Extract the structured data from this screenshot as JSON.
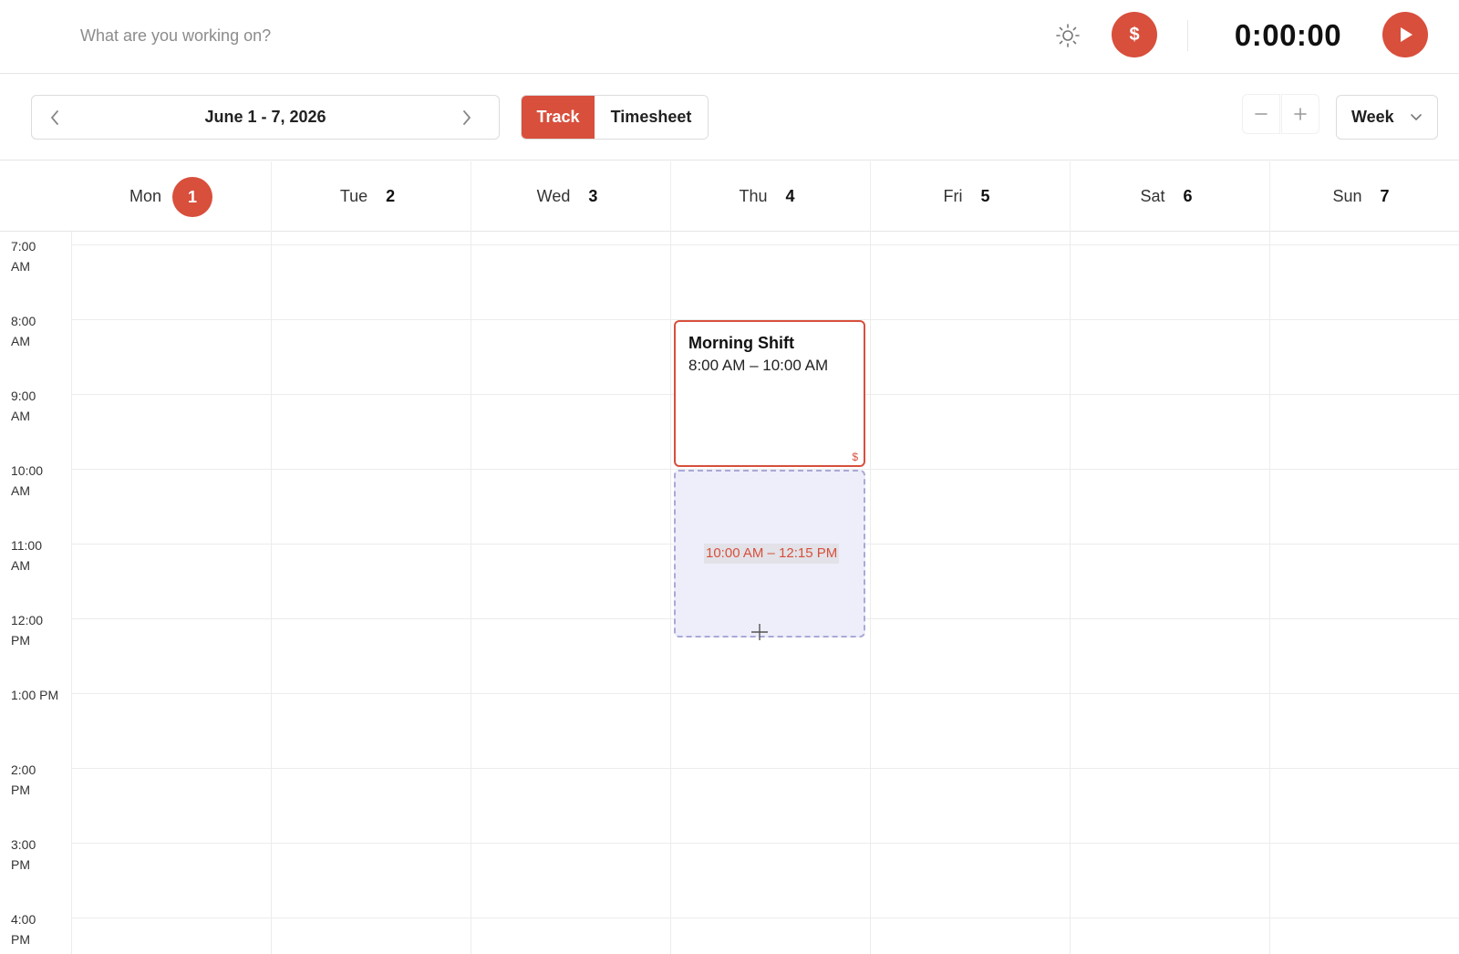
{
  "topbar": {
    "task_placeholder": "What are you working on?",
    "timer": "0:00:00",
    "billable_symbol": "$",
    "icons": {
      "theme": "sun-icon",
      "billable": "dollar-icon",
      "start": "play-icon"
    }
  },
  "toolbar": {
    "date_range": "June 1 - 7, 2026",
    "modes": {
      "track": "Track",
      "timesheet": "Timesheet"
    },
    "view": "Week"
  },
  "days": [
    {
      "name": "Mon",
      "num": "1",
      "today": true
    },
    {
      "name": "Tue",
      "num": "2",
      "today": false
    },
    {
      "name": "Wed",
      "num": "3",
      "today": false
    },
    {
      "name": "Thu",
      "num": "4",
      "today": false
    },
    {
      "name": "Fri",
      "num": "5",
      "today": false
    },
    {
      "name": "Sat",
      "num": "6",
      "today": false
    },
    {
      "name": "Sun",
      "num": "7",
      "today": false
    }
  ],
  "hours": [
    {
      "l1": "7:00",
      "l2": "AM"
    },
    {
      "l1": "8:00",
      "l2": "AM"
    },
    {
      "l1": "9:00",
      "l2": "AM"
    },
    {
      "l1": "10:00",
      "l2": "AM"
    },
    {
      "l1": "11:00",
      "l2": "AM"
    },
    {
      "l1": "12:00",
      "l2": "PM"
    },
    {
      "l1": "1:00 PM",
      "l2": ""
    },
    {
      "l1": "2:00",
      "l2": "PM"
    },
    {
      "l1": "3:00",
      "l2": "PM"
    },
    {
      "l1": "4:00",
      "l2": "PM"
    }
  ],
  "event": {
    "title": "Morning Shift",
    "time": "8:00 AM – 10:00 AM",
    "billable_mark": "$"
  },
  "draft": {
    "range": "10:00 AM – 12:15 PM"
  },
  "colors": {
    "accent": "#d84f3c",
    "draft_bg": "#eeeefb",
    "draft_border": "#a9a9d6",
    "grid": "#ececec"
  }
}
